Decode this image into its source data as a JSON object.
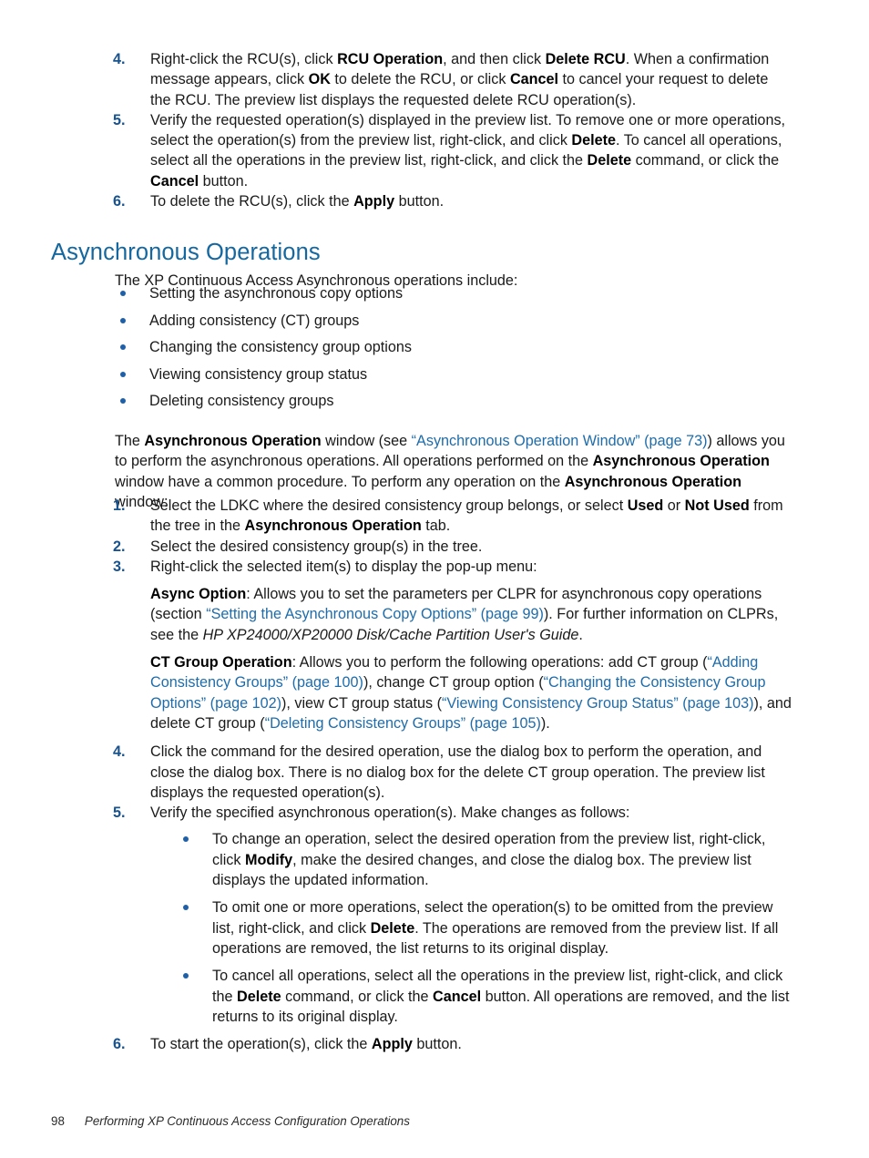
{
  "colors": {
    "heading": "#15679f",
    "link": "#1e6cab",
    "marker": "#19538e",
    "bullet": "#1f5fa8",
    "body": "#181818"
  },
  "top_steps": [
    {
      "marker": "4.",
      "parts": [
        {
          "t": "Right-click the RCU(s), click ",
          "s": "n"
        },
        {
          "t": "RCU Operation",
          "s": "b"
        },
        {
          "t": ", and then click ",
          "s": "n"
        },
        {
          "t": "Delete RCU",
          "s": "b"
        },
        {
          "t": ". When a confirmation message appears, click ",
          "s": "n"
        },
        {
          "t": "OK",
          "s": "b"
        },
        {
          "t": " to delete the RCU, or click ",
          "s": "n"
        },
        {
          "t": "Cancel",
          "s": "b"
        },
        {
          "t": " to cancel your request to delete the RCU. The preview list displays the requested delete RCU operation(s).",
          "s": "n"
        }
      ]
    },
    {
      "marker": "5.",
      "parts": [
        {
          "t": "Verify the requested operation(s) displayed in the preview list. To remove one or more operations, select the operation(s) from the preview list, right-click, and click ",
          "s": "n"
        },
        {
          "t": "Delete",
          "s": "b"
        },
        {
          "t": ". To cancel all operations, select all the operations in the preview list, right-click, and click the ",
          "s": "n"
        },
        {
          "t": "Delete",
          "s": "b"
        },
        {
          "t": " command, or click the ",
          "s": "n"
        },
        {
          "t": "Cancel",
          "s": "b"
        },
        {
          "t": " button.",
          "s": "n"
        }
      ]
    },
    {
      "marker": "6.",
      "parts": [
        {
          "t": "To delete the RCU(s), click the ",
          "s": "n"
        },
        {
          "t": "Apply",
          "s": "b"
        },
        {
          "t": " button.",
          "s": "n"
        }
      ]
    }
  ],
  "section": {
    "heading": "Asynchronous Operations",
    "intro": "The XP Continuous Access Asynchronous operations include:",
    "bullets": [
      "Setting the asynchronous copy options",
      "Adding consistency (CT) groups",
      "Changing the consistency group options",
      "Viewing consistency group status",
      "Deleting consistency groups"
    ]
  },
  "window_para": {
    "parts": [
      {
        "t": "The ",
        "s": "n"
      },
      {
        "t": "Asynchronous Operation",
        "s": "b"
      },
      {
        "t": " window (see ",
        "s": "n"
      },
      {
        "t": "“Asynchronous Operation Window” (page 73)",
        "s": "l"
      },
      {
        "t": ") allows you to perform the asynchronous operations. All operations performed on the ",
        "s": "n"
      },
      {
        "t": "Asynchronous Operation",
        "s": "b"
      },
      {
        "t": " window have a common procedure. To perform any operation on the ",
        "s": "n"
      },
      {
        "t": "Asynchronous Operation",
        "s": "b"
      },
      {
        "t": " window:",
        "s": "n"
      }
    ]
  },
  "proc_steps": {
    "step1": {
      "marker": "1.",
      "parts": [
        {
          "t": "Select the LDKC where the desired consistency group belongs, or select ",
          "s": "n"
        },
        {
          "t": "Used",
          "s": "b"
        },
        {
          "t": " or ",
          "s": "n"
        },
        {
          "t": "Not Used",
          "s": "b"
        },
        {
          "t": " from the tree in the ",
          "s": "n"
        },
        {
          "t": "Asynchronous Operation",
          "s": "b"
        },
        {
          "t": " tab.",
          "s": "n"
        }
      ]
    },
    "step2": {
      "marker": "2.",
      "parts": [
        {
          "t": "Select the desired consistency group(s) in the tree.",
          "s": "n"
        }
      ]
    },
    "step3": {
      "marker": "3.",
      "parts": [
        {
          "t": "Right-click the selected item(s) to display the pop-up menu:",
          "s": "n"
        }
      ],
      "async_option": [
        {
          "t": "Async Option",
          "s": "b"
        },
        {
          "t": ": Allows you to set the parameters per CLPR for asynchronous copy operations (section ",
          "s": "n"
        },
        {
          "t": "“Setting the Asynchronous Copy Options” (page 99)",
          "s": "l"
        },
        {
          "t": "). For further information on CLPRs, see the ",
          "s": "n"
        },
        {
          "t": "HP XP24000/XP20000 Disk/Cache Partition User's Guide",
          "s": "i"
        },
        {
          "t": ".",
          "s": "n"
        }
      ],
      "ct_group_operation": [
        {
          "t": "CT Group Operation",
          "s": "b"
        },
        {
          "t": ": Allows you to perform the following operations: add CT group (",
          "s": "n"
        },
        {
          "t": "“Adding Consistency Groups” (page 100)",
          "s": "l"
        },
        {
          "t": "), change CT group option (",
          "s": "n"
        },
        {
          "t": "“Changing the Consistency Group Options” (page 102)",
          "s": "l"
        },
        {
          "t": "), view CT group status (",
          "s": "n"
        },
        {
          "t": "“Viewing Consistency Group Status” (page 103)",
          "s": "l"
        },
        {
          "t": "), and delete CT group (",
          "s": "n"
        },
        {
          "t": "“Deleting Consistency Groups” (page 105)",
          "s": "l"
        },
        {
          "t": ").",
          "s": "n"
        }
      ]
    },
    "step4": {
      "marker": "4.",
      "parts": [
        {
          "t": "Click the command for the desired operation, use the dialog box to perform the operation, and close the dialog box. There is no dialog box for the delete CT group operation. The preview list displays the requested operation(s).",
          "s": "n"
        }
      ]
    },
    "step5": {
      "marker": "5.",
      "parts": [
        {
          "t": "Verify the specified asynchronous operation(s). Make changes as follows:",
          "s": "n"
        }
      ],
      "bullets": [
        [
          {
            "t": "To change an operation, select the desired operation from the preview list, right-click, click ",
            "s": "n"
          },
          {
            "t": "Modify",
            "s": "b"
          },
          {
            "t": ", make the desired changes, and close the dialog box. The preview list displays the updated information.",
            "s": "n"
          }
        ],
        [
          {
            "t": "To omit one or more operations, select the operation(s) to be omitted from the preview list, right-click, and click ",
            "s": "n"
          },
          {
            "t": "Delete",
            "s": "b"
          },
          {
            "t": ". The operations are removed from the preview list. If all operations are removed, the list returns to its original display.",
            "s": "n"
          }
        ],
        [
          {
            "t": "To cancel all operations, select all the operations in the preview list, right-click, and click the ",
            "s": "n"
          },
          {
            "t": "Delete",
            "s": "b"
          },
          {
            "t": " command, or click the ",
            "s": "n"
          },
          {
            "t": "Cancel",
            "s": "b"
          },
          {
            "t": " button. All operations are removed, and the list returns to its original display.",
            "s": "n"
          }
        ]
      ]
    },
    "step6": {
      "marker": "6.",
      "parts": [
        {
          "t": "To start the operation(s), click the ",
          "s": "n"
        },
        {
          "t": "Apply",
          "s": "b"
        },
        {
          "t": " button.",
          "s": "n"
        }
      ]
    }
  },
  "footer": {
    "page_number": "98",
    "title": "Performing XP Continuous Access Configuration Operations"
  }
}
